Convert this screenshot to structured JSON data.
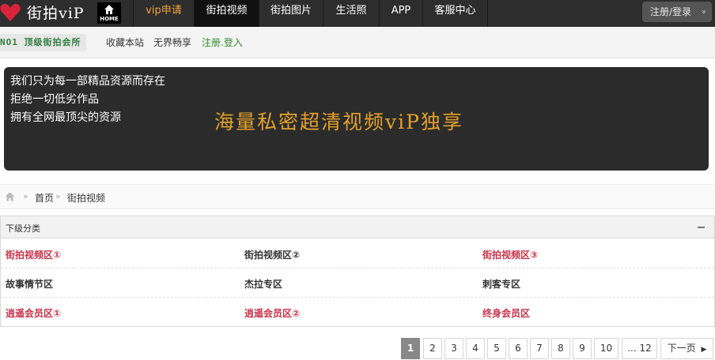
{
  "header": {
    "logo_text": "街拍viP",
    "home_label": "HOME",
    "nav": [
      {
        "label": "vip申请",
        "style": "vip",
        "active": false
      },
      {
        "label": "街拍视频",
        "style": "normal",
        "active": true
      },
      {
        "label": "街拍图片",
        "style": "normal",
        "active": false
      },
      {
        "label": "生活照",
        "style": "normal",
        "active": false
      },
      {
        "label": "APP",
        "style": "normal",
        "active": false
      },
      {
        "label": "客服中心",
        "style": "normal",
        "active": false
      }
    ],
    "login_label": "注册/登录",
    "login_caret": "»"
  },
  "subbar": {
    "badge": "NO1 顶级街拍会所",
    "links": [
      "收藏本站",
      "无界畅享",
      "注册.登入"
    ]
  },
  "banner": {
    "lines": [
      "我们只为每一部精品资源而存在",
      "拒绝一切低劣作品",
      "拥有全网最顶尖的资源"
    ],
    "slogan": "海量私密超清视频viP独享"
  },
  "breadcrumb": {
    "sep": "»",
    "items": [
      "首页",
      "街拍视频"
    ]
  },
  "categories": {
    "title": "下级分类",
    "rows": [
      [
        {
          "label": "街拍视频区①",
          "color": "red"
        },
        {
          "label": "街拍视频区②",
          "color": "dark"
        },
        {
          "label": "街拍视频区③",
          "color": "red"
        }
      ],
      [
        {
          "label": "故事情节区",
          "color": "dark"
        },
        {
          "label": "杰拉专区",
          "color": "dark"
        },
        {
          "label": "刺客专区",
          "color": "dark"
        }
      ],
      [
        {
          "label": "逍遥会员区①",
          "color": "red"
        },
        {
          "label": "逍遥会员区②",
          "color": "red"
        },
        {
          "label": "终身会员区",
          "color": "red"
        }
      ]
    ]
  },
  "pagination": {
    "current": "1",
    "pages": [
      "1",
      "2",
      "3",
      "4",
      "5",
      "6",
      "7",
      "8",
      "9",
      "10",
      "... 12"
    ],
    "next_label": "下一页",
    "next_arrow": "▶"
  },
  "colors": {
    "topbar_bg": "#2d2d2d",
    "vip_accent": "#f0a23c",
    "banner_bg": "#2b2b2b",
    "slogan": "#e2a12b",
    "category_red": "#c8324a",
    "register_green": "#2e8b2e"
  }
}
